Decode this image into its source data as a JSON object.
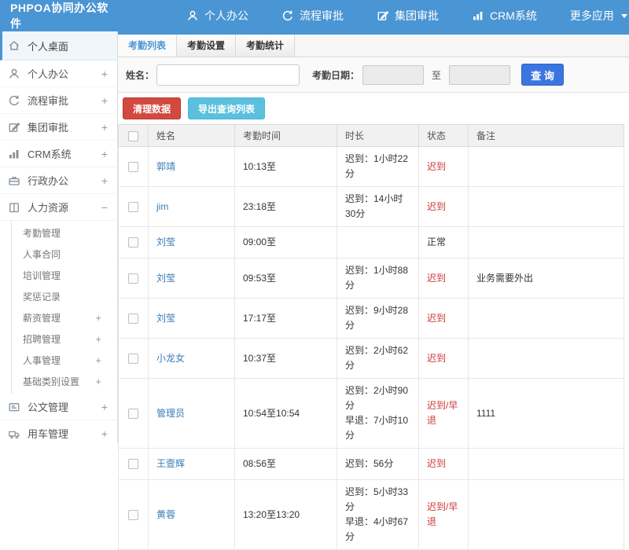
{
  "topbar": {
    "brand": "PHPOA协同办公软件",
    "nav": [
      {
        "label": "个人办公",
        "icon": "person-icon"
      },
      {
        "label": "流程审批",
        "icon": "process-icon"
      },
      {
        "label": "集团审批",
        "icon": "edit-icon"
      },
      {
        "label": "CRM系统",
        "icon": "bar-chart-icon"
      },
      {
        "label": "更多应用",
        "icon": "caret-down-icon"
      }
    ]
  },
  "sidebar": {
    "items_top": [
      {
        "label": "个人桌面",
        "icon": "home-icon",
        "expand": "",
        "active": true
      },
      {
        "label": "个人办公",
        "icon": "person-icon",
        "expand": "+"
      },
      {
        "label": "流程审批",
        "icon": "process-icon",
        "expand": "+"
      },
      {
        "label": "集团审批",
        "icon": "edit-icon",
        "expand": "+"
      },
      {
        "label": "CRM系统",
        "icon": "bar-chart-icon",
        "expand": "+"
      },
      {
        "label": "行政办公",
        "icon": "briefcase-icon",
        "expand": "+"
      },
      {
        "label": "人力资源",
        "icon": "book-icon",
        "expand": "−"
      }
    ],
    "hr_subitems": [
      {
        "label": "考勤管理",
        "expand": ""
      },
      {
        "label": "人事合同",
        "expand": ""
      },
      {
        "label": "培训管理",
        "expand": ""
      },
      {
        "label": "奖惩记录",
        "expand": ""
      },
      {
        "label": "薪资管理",
        "expand": "+"
      },
      {
        "label": "招聘管理",
        "expand": "+"
      },
      {
        "label": "人事管理",
        "expand": "+"
      },
      {
        "label": "基础类别设置",
        "expand": "+"
      }
    ],
    "items_bottom": [
      {
        "label": "公文管理",
        "icon": "document-icon",
        "expand": "+"
      },
      {
        "label": "用车管理",
        "icon": "truck-icon",
        "expand": "+"
      }
    ]
  },
  "tabs": [
    {
      "label": "考勤列表",
      "active": true
    },
    {
      "label": "考勤设置",
      "active": false
    },
    {
      "label": "考勤统计",
      "active": false
    }
  ],
  "filter": {
    "name_label": "姓名：",
    "name_value": "",
    "date_label": "考勤日期：",
    "date_from": "",
    "to_label": "至",
    "date_to": "",
    "search_button": "查 询"
  },
  "actions": {
    "clear_button": "清理数据",
    "export_button": "导出查询列表"
  },
  "table": {
    "headers": [
      "姓名",
      "考勤时间",
      "时长",
      "状态",
      "备注"
    ],
    "rows": [
      {
        "name": "郭靖",
        "time": "10:13至",
        "duration": "迟到：1小时22分",
        "status": "迟到",
        "note": ""
      },
      {
        "name": "jim",
        "time": "23:18至",
        "duration": "迟到：14小时30分",
        "status": "迟到",
        "note": ""
      },
      {
        "name": "刘莹",
        "time": "09:00至",
        "duration": "",
        "status": "正常",
        "note": ""
      },
      {
        "name": "刘莹",
        "time": "09:53至",
        "duration": "迟到：1小时88分",
        "status": "迟到",
        "note": "业务需要外出"
      },
      {
        "name": "刘莹",
        "time": "17:17至",
        "duration": "迟到：9小时28分",
        "status": "迟到",
        "note": ""
      },
      {
        "name": "小龙女",
        "time": "10:37至",
        "duration": "迟到：2小时62分",
        "status": "迟到",
        "note": ""
      },
      {
        "name": "管理员",
        "time": "10:54至10:54",
        "duration": "迟到：2小时90分\n早退：7小时10分",
        "status": "迟到/早退",
        "note": "1111"
      },
      {
        "name": "王壹辉",
        "time": "08:56至",
        "duration": "迟到：56分",
        "status": "迟到",
        "note": ""
      },
      {
        "name": "黄蓉",
        "time": "13:20至13:20",
        "duration": "迟到：5小时33分\n早退：4小时67分",
        "status": "迟到/早退",
        "note": ""
      }
    ]
  },
  "colors": {
    "topbar_blue": "#4a95d3",
    "search_button_blue": "#3b76e0",
    "link_blue": "#3a7cb8",
    "status_red": "#cc3a3a",
    "danger_red": "#d2493f",
    "export_teal": "#5bc0de"
  }
}
